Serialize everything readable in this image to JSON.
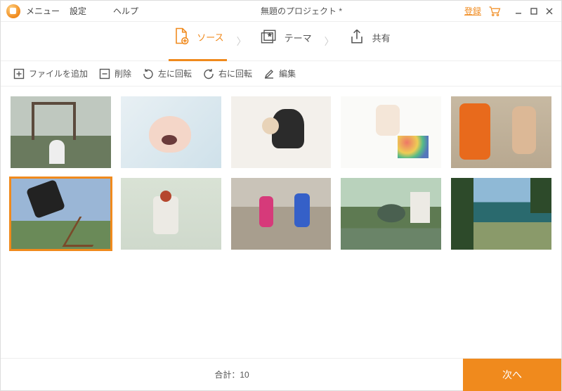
{
  "menubar": {
    "menu": "メニュー",
    "settings": "設定",
    "help": "ヘルプ",
    "register": "登録"
  },
  "title": "無題のプロジェクト *",
  "steps": {
    "source": "ソース",
    "theme": "テーマ",
    "share": "共有"
  },
  "toolbar": {
    "add_file": "ファイルを追加",
    "delete": "削除",
    "rotate_left": "左に回転",
    "rotate_right": "右に回転",
    "edit": "編集"
  },
  "gallery": {
    "selected_index": 5,
    "count": 10
  },
  "footer": {
    "total_label": "合計：",
    "total_count": "10",
    "next": "次へ"
  }
}
